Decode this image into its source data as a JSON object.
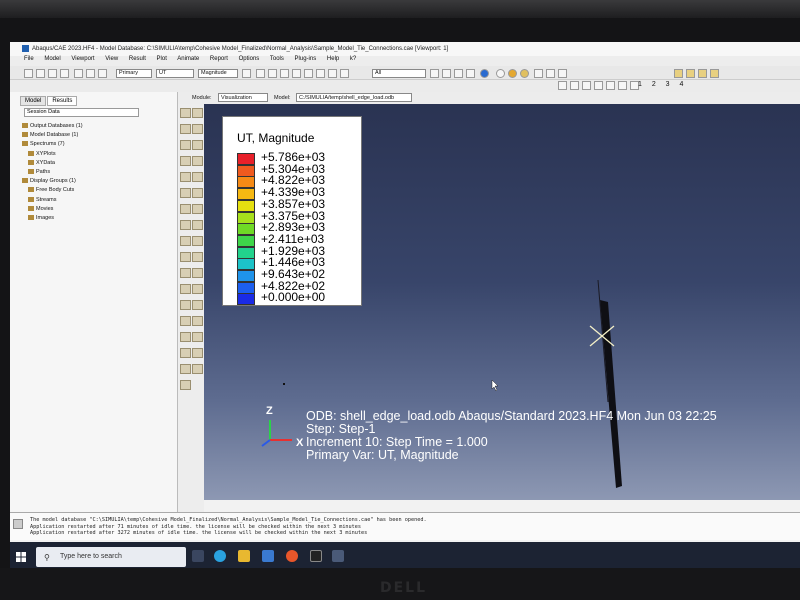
{
  "window": {
    "title": "Abaqus/CAE 2023.HF4 - Model Database: C:\\SIMULIA\\temp\\Cohesive Model_Finalized\\Normal_Analysis\\Sample_Model_Tie_Connections.cae [Viewport: 1]"
  },
  "menu": [
    "File",
    "Model",
    "Viewport",
    "View",
    "Result",
    "Plot",
    "Animate",
    "Report",
    "Options",
    "Tools",
    "Plug-ins",
    "Help",
    "k?"
  ],
  "toolbar": {
    "primary_select": "Primary",
    "variable_select": "UT",
    "magnitude_select": "Magnitude",
    "filter_select": "All",
    "view_numbers": "1 2 3 4"
  },
  "left_panel": {
    "tabs": [
      "Model",
      "Results"
    ],
    "session_select": "Session Data",
    "tree": [
      {
        "label": "Output Databases (1)",
        "indent": false
      },
      {
        "label": "Model Database (1)",
        "indent": false
      },
      {
        "label": "Spectrums (7)",
        "indent": false
      },
      {
        "label": "XYPlots",
        "indent": true
      },
      {
        "label": "XYData",
        "indent": true
      },
      {
        "label": "Paths",
        "indent": true
      },
      {
        "label": "Display Groups (1)",
        "indent": false
      },
      {
        "label": "Free Body Cuts",
        "indent": true
      },
      {
        "label": "Streams",
        "indent": true
      },
      {
        "label": "Movies",
        "indent": true
      },
      {
        "label": "Images",
        "indent": true
      }
    ]
  },
  "module_bar": {
    "module_label": "Module:",
    "module_value": "Visualization",
    "model_label": "Model:",
    "model_value": "C:/SIMULIA/temp/shell_edge_load.odb"
  },
  "legend": {
    "title": "UT, Magnitude",
    "entries": [
      {
        "value": "+5.786e+03",
        "color": "#e8202a"
      },
      {
        "value": "+5.304e+03",
        "color": "#ef5a1f"
      },
      {
        "value": "+4.822e+03",
        "color": "#f58a16"
      },
      {
        "value": "+4.339e+03",
        "color": "#f6b812"
      },
      {
        "value": "+3.857e+03",
        "color": "#e5e010"
      },
      {
        "value": "+3.375e+03",
        "color": "#a7e01c"
      },
      {
        "value": "+2.893e+03",
        "color": "#6fda26"
      },
      {
        "value": "+2.411e+03",
        "color": "#3ed64a"
      },
      {
        "value": "+1.929e+03",
        "color": "#22d28c"
      },
      {
        "value": "+1.446e+03",
        "color": "#1cc3c8"
      },
      {
        "value": "+9.643e+02",
        "color": "#1f93ea"
      },
      {
        "value": "+4.822e+02",
        "color": "#1c5ff0"
      },
      {
        "value": "+0.000e+00",
        "color": "#1a2be6"
      }
    ]
  },
  "viewport_info": {
    "line1": "ODB: shell_edge_load.odb    Abaqus/Standard 2023.HF4    Mon Jun 03 22:25",
    "line2": "Step: Step-1",
    "line3": "Increment     10: Step Time =     1.000",
    "line4": "Primary Var: UT, Magnitude"
  },
  "triad": {
    "z": "Z",
    "x": "X"
  },
  "messages": [
    "The model database \"C:\\SIMULIA\\temp\\Cohesive Model_Finalized\\Normal_Analysis\\Sample_Model_Tie_Connections.cae\" has been opened.",
    "Application restarted after 71 minutes of idle time. the license will be checked within the next 3 minutes",
    "Application restarted after 3272 minutes of idle time. the license will be checked within the next 3 minutes"
  ],
  "taskbar": {
    "search_placeholder": "Type here to search"
  },
  "bezel": {
    "brand": "DELL"
  }
}
